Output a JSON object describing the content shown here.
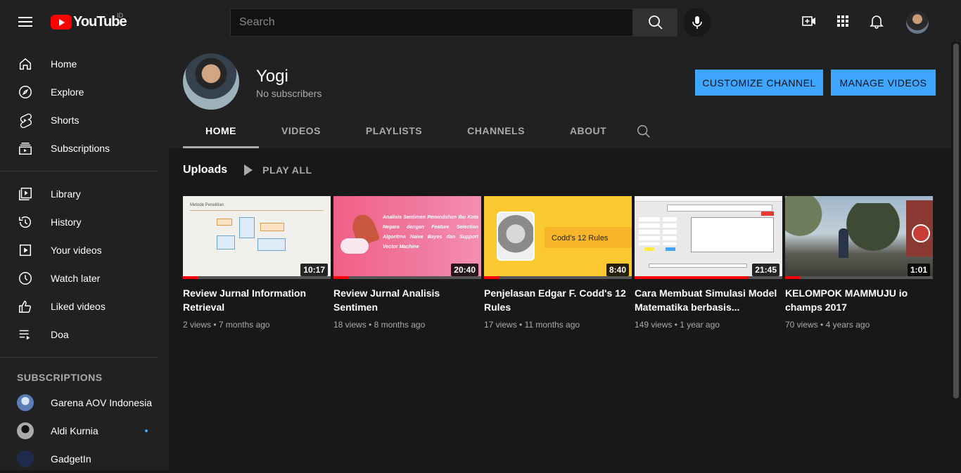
{
  "header": {
    "logo_text": "YouTube",
    "country": "ID",
    "search_placeholder": "Search"
  },
  "sidebar": {
    "main": [
      {
        "label": "Home",
        "icon": "home-icon"
      },
      {
        "label": "Explore",
        "icon": "compass-icon"
      },
      {
        "label": "Shorts",
        "icon": "shorts-icon"
      },
      {
        "label": "Subscriptions",
        "icon": "subscriptions-icon"
      }
    ],
    "library": [
      {
        "label": "Library",
        "icon": "library-icon"
      },
      {
        "label": "History",
        "icon": "history-icon"
      },
      {
        "label": "Your videos",
        "icon": "your-videos-icon"
      },
      {
        "label": "Watch later",
        "icon": "clock-icon"
      },
      {
        "label": "Liked videos",
        "icon": "thumbs-up-icon"
      },
      {
        "label": "Doa",
        "icon": "playlist-icon"
      }
    ],
    "subscriptions_title": "SUBSCRIPTIONS",
    "subscriptions": [
      {
        "label": "Garena AOV Indonesia",
        "color": "#5a7db8"
      },
      {
        "label": "Aldi Kurnia",
        "color": "#888888",
        "new": true
      },
      {
        "label": "GadgetIn",
        "color": "#1e2a4a"
      }
    ]
  },
  "channel": {
    "name": "Yogi",
    "subscribers": "No subscribers",
    "customize_label": "CUSTOMIZE CHANNEL",
    "manage_label": "MANAGE VIDEOS",
    "tabs": [
      "HOME",
      "VIDEOS",
      "PLAYLISTS",
      "CHANNELS",
      "ABOUT"
    ],
    "active_tab": "HOME"
  },
  "uploads": {
    "title": "Uploads",
    "play_all": "PLAY ALL",
    "videos": [
      {
        "title": "Review Jurnal Information Retrieval",
        "duration": "10:17",
        "views": "2 views",
        "age": "7 months ago",
        "progress": 0.1,
        "thumb_caption": "Metode Penelitian"
      },
      {
        "title": "Review Jurnal Analisis Sentimen",
        "duration": "20:40",
        "views": "18 views",
        "age": "8 months ago",
        "progress": 0.1,
        "thumb_caption": "Analisis Sentimen Pemindahan Ibu Kota Negara dengan Feature Selection Algoritma Naive Bayes dan Support Vector Machine"
      },
      {
        "title": "Penjelasan Edgar F. Codd's 12 Rules",
        "duration": "8:40",
        "views": "17 views",
        "age": "11 months ago",
        "progress": 0.1,
        "thumb_caption": "Codd's 12 Rules"
      },
      {
        "title": "Cara Membuat Simulasi Model Matematika berbasis...",
        "duration": "21:45",
        "views": "149 views",
        "age": "1 year ago",
        "progress": 0.77,
        "thumb_caption": ""
      },
      {
        "title": "KELOMPOK MAMMUJU io champs 2017",
        "duration": "1:01",
        "views": "70 views",
        "age": "4 years ago",
        "progress": 0.1,
        "thumb_caption": ""
      }
    ]
  },
  "colors": {
    "accent": "#3ea6ff",
    "brand": "#ff0000"
  }
}
